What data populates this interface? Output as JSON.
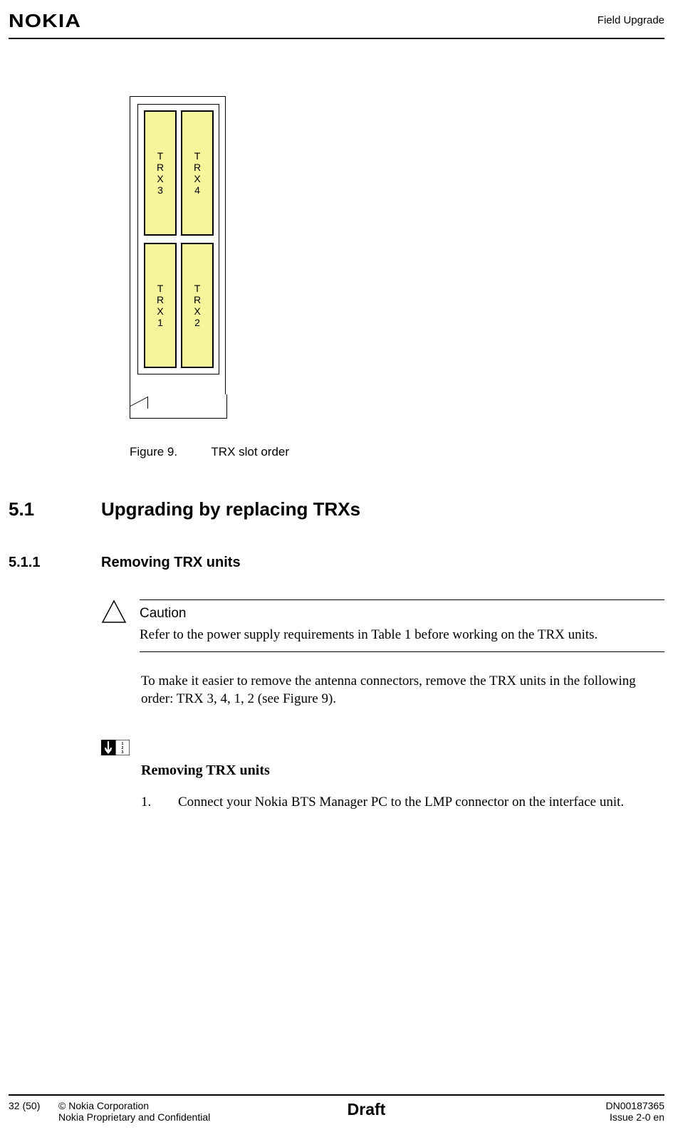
{
  "header": {
    "logo": "NOKIA",
    "right": "Field Upgrade"
  },
  "figure": {
    "slots": {
      "trx3": "T\nR\nX\n3",
      "trx4": "T\nR\nX\n4",
      "trx1": "T\nR\nX\n1",
      "trx2": "T\nR\nX\n2"
    },
    "caption_label": "Figure 9.",
    "caption_text": "TRX slot order"
  },
  "section": {
    "num": "5.1",
    "title": "Upgrading by replacing TRXs"
  },
  "subsection": {
    "num": "5.1.1",
    "title": "Removing TRX units"
  },
  "caution": {
    "title": "Caution",
    "text": "Refer to the power supply requirements in Table 1 before working on the TRX units."
  },
  "body": {
    "para1": "To make it easier to remove the antenna connectors, remove the TRX units in the following order: TRX 3, 4, 1, 2 (see Figure 9)."
  },
  "steps": {
    "icon_digits": "1\n2\n3",
    "heading": "Removing TRX units",
    "items": [
      {
        "n": "1.",
        "text": "Connect your Nokia BTS Manager PC to the LMP connector on the interface unit."
      }
    ]
  },
  "footer": {
    "page": "32 (50)",
    "copyright": "© Nokia Corporation",
    "proprietary": "Nokia Proprietary and Confidential",
    "draft": "Draft",
    "docnum": "DN00187365",
    "issue": "Issue 2-0 en"
  }
}
